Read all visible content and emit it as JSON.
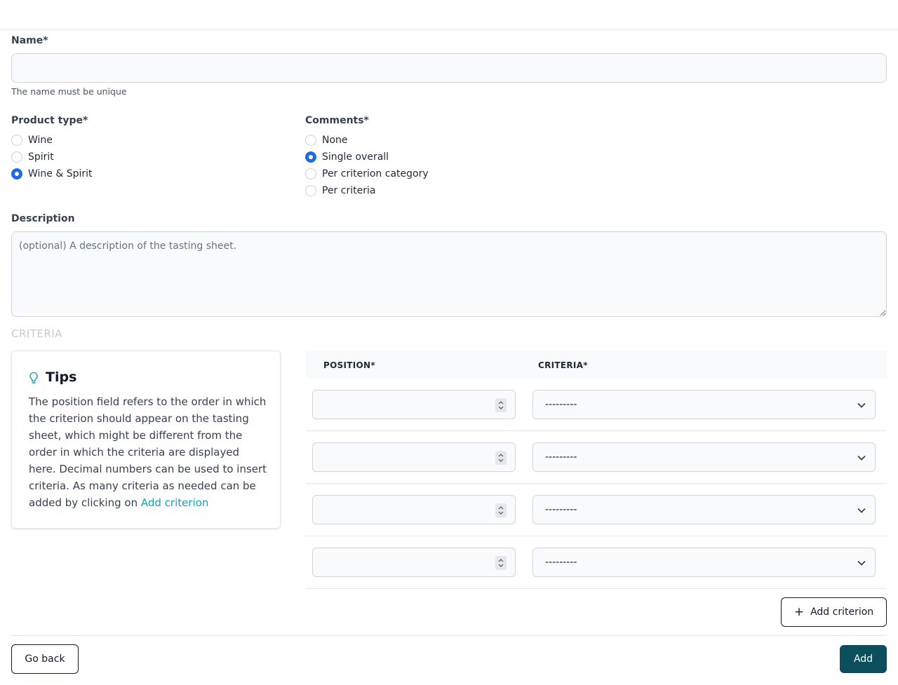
{
  "form": {
    "name_label": "Name*",
    "name_value": "",
    "name_hint": "The name must be unique",
    "product_type": {
      "label": "Product type*",
      "options": [
        "Wine",
        "Spirit",
        "Wine & Spirit"
      ],
      "selected": "Wine & Spirit"
    },
    "comments": {
      "label": "Comments*",
      "options": [
        "None",
        "Single overall",
        "Per criterion category",
        "Per criteria"
      ],
      "selected": "Single overall"
    },
    "description_label": "Description",
    "description_placeholder": "(optional) A description of the tasting sheet."
  },
  "criteria": {
    "section_title": "CRITERIA",
    "tips": {
      "icon": "lightbulb-icon",
      "title": "Tips",
      "text": "The position field refers to the order in which the criterion should appear on the tasting sheet, which might be different from the order in which the criteria are displayed here. Decimal numbers can be used to insert criteria. As many criteria as needed can be added by clicking on",
      "link_text": "Add criterion"
    },
    "columns": [
      "POSITION*",
      "CRITERIA*"
    ],
    "rows": [
      {
        "position": "",
        "criteria": "---------"
      },
      {
        "position": "",
        "criteria": "---------"
      },
      {
        "position": "",
        "criteria": "---------"
      },
      {
        "position": "",
        "criteria": "---------"
      }
    ],
    "add_button": "Add criterion"
  },
  "footer": {
    "back_button": "Go back",
    "submit_button": "Add"
  },
  "colors": {
    "accent": "#1d6ae5",
    "primary_button": "#0b4f5c",
    "link": "#16a3b8"
  }
}
